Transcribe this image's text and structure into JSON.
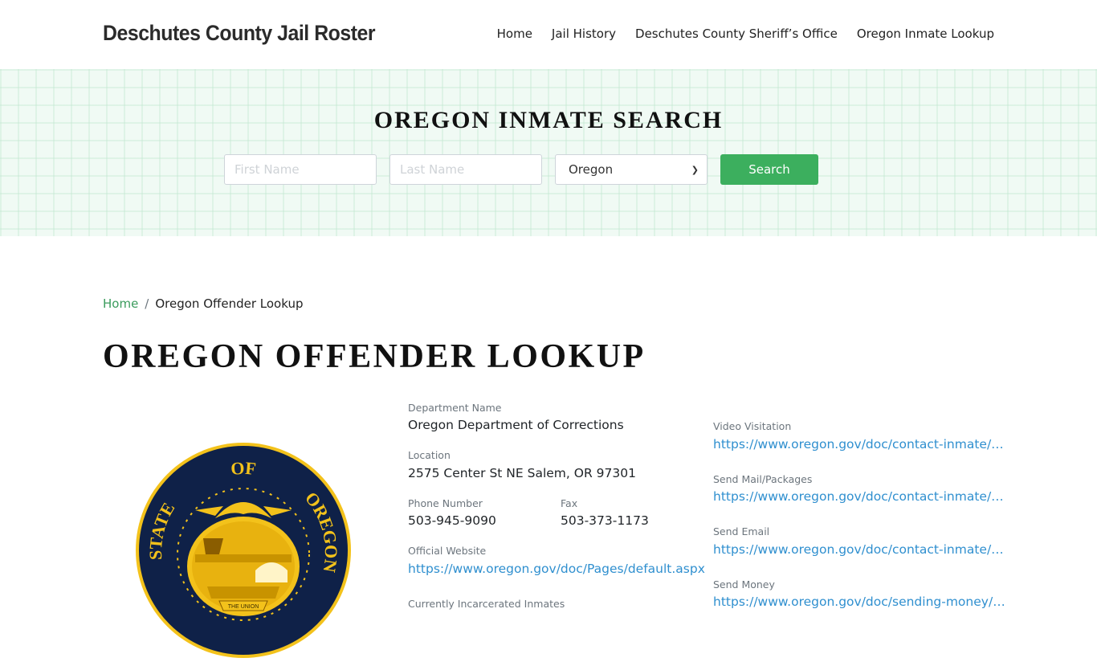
{
  "header": {
    "brand": "Deschutes County Jail Roster",
    "nav": [
      "Home",
      "Jail History",
      "Deschutes County Sheriff’s Office",
      "Oregon Inmate Lookup"
    ]
  },
  "search": {
    "title": "OREGON INMATE SEARCH",
    "first_name_placeholder": "First Name",
    "last_name_placeholder": "Last Name",
    "state_selected": "Oregon",
    "button_label": "Search"
  },
  "breadcrumb": {
    "home": "Home",
    "separator": "/",
    "current": "Oregon Offender Lookup"
  },
  "page_title": "OREGON OFFENDER LOOKUP",
  "seal": {
    "top_text": "OF",
    "left_text": "STATE",
    "right_text": "OREGON",
    "banner": "THE UNION"
  },
  "department": {
    "name_label": "Department Name",
    "name": "Oregon Department of Corrections",
    "location_label": "Location",
    "location": "2575 Center St NE Salem, OR 97301",
    "phone_label": "Phone Number",
    "phone": "503-945-9090",
    "fax_label": "Fax",
    "fax": "503-373-1173",
    "website_label": "Official Website",
    "website": "https://www.oregon.gov/doc/Pages/default.aspx",
    "inmates_label": "Currently Incarcerated Inmates"
  },
  "contact_links": {
    "video_label": "Video Visitation",
    "video_url": "https://www.oregon.gov/doc/contact-inmate/Pages/video-visitation.aspx",
    "mail_label": "Send Mail/Packages",
    "mail_url": "https://www.oregon.gov/doc/contact-inmate/Pages/send-mail.aspx",
    "email_label": "Send Email",
    "email_url": "https://www.oregon.gov/doc/contact-inmate/Pages/send-email.aspx",
    "money_label": "Send Money",
    "money_url": "https://www.oregon.gov/doc/sending-money/Pages/default.aspx"
  },
  "colors": {
    "accent_green": "#3caf5e",
    "link_blue": "#2f8fcf",
    "seal_navy": "#0f2148",
    "seal_gold": "#f3c21b"
  }
}
